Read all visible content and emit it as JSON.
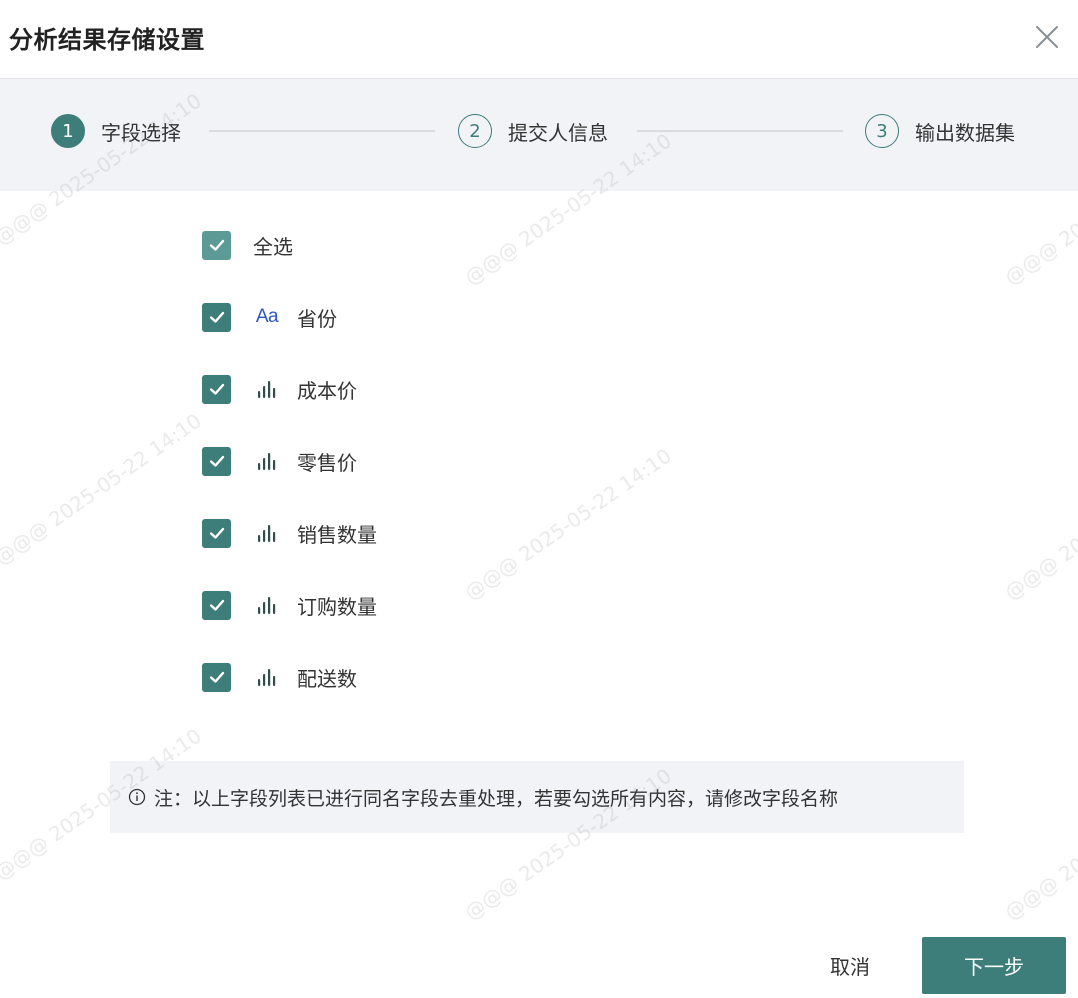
{
  "dialog": {
    "title": "分析结果存储设置",
    "close_icon": "close-icon"
  },
  "steps": [
    {
      "number": "1",
      "label": "字段选择",
      "state": "active"
    },
    {
      "number": "2",
      "label": "提交人信息",
      "state": "pending"
    },
    {
      "number": "3",
      "label": "输出数据集",
      "state": "pending"
    }
  ],
  "select_all": {
    "label": "全选",
    "checked": true
  },
  "fields": [
    {
      "label": "省份",
      "type_icon": "text-type-icon",
      "type_text": "Aa",
      "checked": true
    },
    {
      "label": "成本价",
      "type_icon": "numeric-bar-icon",
      "checked": true
    },
    {
      "label": "零售价",
      "type_icon": "numeric-bar-icon",
      "checked": true
    },
    {
      "label": "销售数量",
      "type_icon": "numeric-bar-icon",
      "checked": true
    },
    {
      "label": "订购数量",
      "type_icon": "numeric-bar-icon",
      "checked": true
    },
    {
      "label": "配送数",
      "type_icon": "numeric-bar-icon",
      "checked": true
    }
  ],
  "notice": {
    "icon": "info-icon",
    "text": "注：以上字段列表已进行同名字段去重处理，若要勾选所有内容，请修改字段名称"
  },
  "footer": {
    "cancel_label": "取消",
    "next_label": "下一步"
  },
  "watermark": {
    "text": "@@@  2025-05-22 14:10"
  },
  "colors": {
    "accent": "#3d7d7a",
    "select_all_checkbox": "#5c9a96",
    "text_type_icon": "#2a56c6",
    "panel_background": "#f2f3f7"
  }
}
